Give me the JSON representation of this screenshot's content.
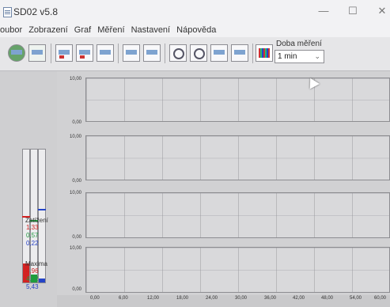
{
  "window": {
    "title": "SD02 v5.8",
    "minimize": "—",
    "maximize": "☐",
    "close": "✕"
  },
  "menu": [
    "oubor",
    "Zobrazení",
    "Graf",
    "Měření",
    "Nastavení",
    "Nápověda"
  ],
  "toolbar": {
    "doba_label": "Doba měření",
    "doba_value": "1 min",
    "caret": "⌄"
  },
  "left_panel": {
    "zatizeni_title": "Zatížení",
    "zatizeni_values": [
      "1,33",
      "0,57",
      "0,22"
    ],
    "maxima_title": "Maxima",
    "maxima_values": [
      "4,96",
      "4,52",
      "5,43"
    ],
    "meter_fill": [
      0.14,
      0.06,
      0.03
    ],
    "meter_mark": [
      0.49,
      0.46,
      0.54
    ],
    "colors": [
      "#d32222",
      "#1f9d3d",
      "#2544c7"
    ]
  },
  "charts": [
    {
      "ymax": "10,00",
      "ymin": "0,00"
    },
    {
      "ymax": "10,00",
      "ymin": "0,00"
    },
    {
      "ymax": "10,00",
      "ymin": "0,00"
    },
    {
      "ymax": "10,00",
      "ymin": "0,00"
    }
  ],
  "x_ticks": [
    "0,00",
    "6,00",
    "12,00",
    "18,00",
    "24,00",
    "30,00",
    "36,00",
    "42,00",
    "48,00",
    "54,00",
    "60,00"
  ]
}
